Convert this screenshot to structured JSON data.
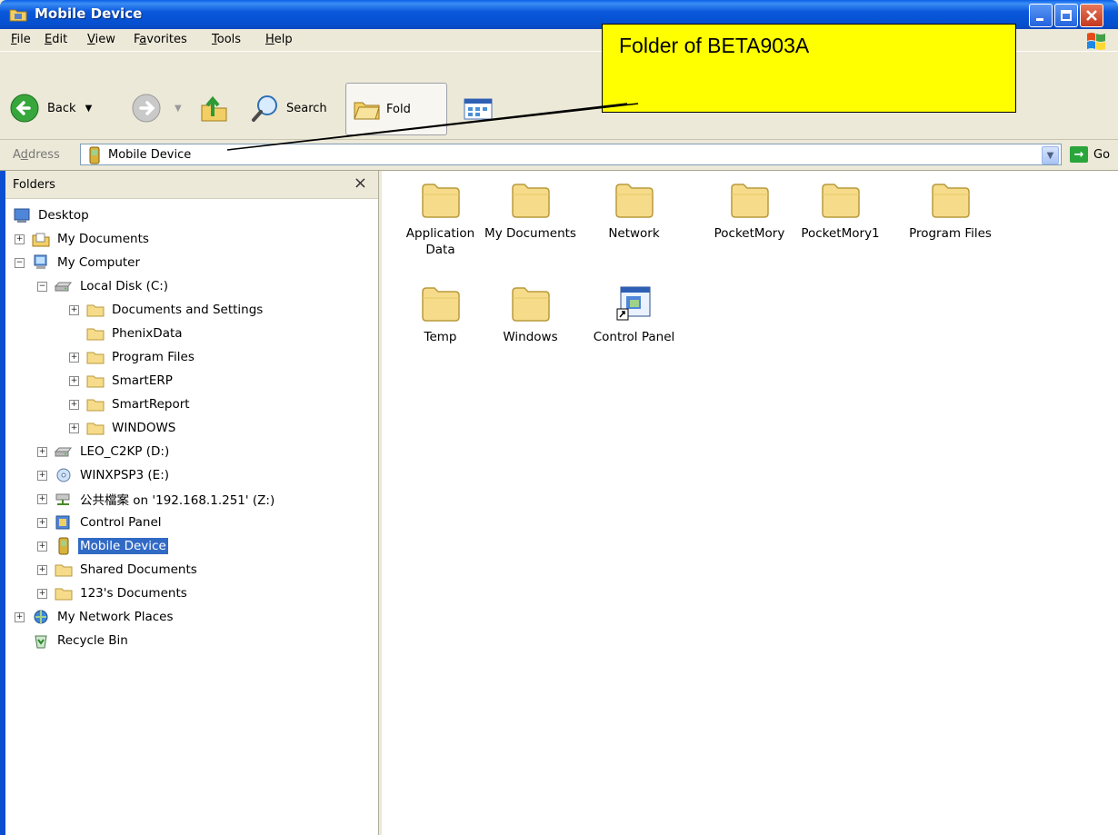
{
  "window": {
    "title": "Mobile Device"
  },
  "menu": [
    {
      "label": "File",
      "u": "F",
      "rest": "ile"
    },
    {
      "label": "Edit",
      "u": "E",
      "rest": "dit"
    },
    {
      "label": "View",
      "u": "V",
      "rest": "iew"
    },
    {
      "label": "Favorites",
      "pre": "F",
      "u": "a",
      "rest": "vorites"
    },
    {
      "label": "Tools",
      "u": "T",
      "rest": "ools"
    },
    {
      "label": "Help",
      "u": "H",
      "rest": "elp"
    }
  ],
  "toolbar": {
    "back_label": "Back",
    "search_label": "Search",
    "folders_label": "Fold"
  },
  "address": {
    "label_pre": "A",
    "label_u": "d",
    "label_rest": "dress",
    "value": "Mobile Device",
    "go_label": "Go"
  },
  "folders_pane": {
    "title": "Folders",
    "close": "×",
    "tree": [
      {
        "label": "Desktop",
        "icon": "desktop-icon",
        "level": 0,
        "expander": "none"
      },
      {
        "label": "My Documents",
        "icon": "my-documents-icon",
        "level": 1,
        "expander": "plus"
      },
      {
        "label": "My Computer",
        "icon": "my-computer-icon",
        "level": 1,
        "expander": "minus"
      },
      {
        "label": "Local Disk (C:)",
        "icon": "hard-drive-icon",
        "level": 2,
        "expander": "minus"
      },
      {
        "label": "Documents and Settings",
        "icon": "folder-icon",
        "level": 3,
        "expander": "plus"
      },
      {
        "label": "PhenixData",
        "icon": "folder-icon",
        "level": 3,
        "expander": "none"
      },
      {
        "label": "Program Files",
        "icon": "folder-icon",
        "level": 3,
        "expander": "plus"
      },
      {
        "label": "SmartERP",
        "icon": "folder-icon",
        "level": 3,
        "expander": "plus"
      },
      {
        "label": "SmartReport",
        "icon": "folder-icon",
        "level": 3,
        "expander": "plus"
      },
      {
        "label": "WINDOWS",
        "icon": "folder-icon",
        "level": 3,
        "expander": "plus"
      },
      {
        "label": "LEO_C2KP (D:)",
        "icon": "hard-drive-icon",
        "level": 2,
        "expander": "plus"
      },
      {
        "label": "WINXPSP3 (E:)",
        "icon": "cd-drive-icon",
        "level": 2,
        "expander": "plus"
      },
      {
        "label": "公共檔案 on '192.168.1.251' (Z:)",
        "icon": "network-drive-icon",
        "level": 2,
        "expander": "plus"
      },
      {
        "label": "Control Panel",
        "icon": "control-panel-icon",
        "level": 2,
        "expander": "plus"
      },
      {
        "label": "Mobile Device",
        "icon": "mobile-device-icon",
        "level": 2,
        "expander": "plus",
        "selected": true
      },
      {
        "label": "Shared Documents",
        "icon": "folder-icon",
        "level": 2,
        "expander": "plus"
      },
      {
        "label": "123's Documents",
        "icon": "folder-icon",
        "level": 2,
        "expander": "plus"
      },
      {
        "label": "My Network Places",
        "icon": "network-places-icon",
        "level": 1,
        "expander": "plus"
      },
      {
        "label": "Recycle Bin",
        "icon": "recycle-bin-icon",
        "level": 1,
        "expander": "none"
      }
    ]
  },
  "content": {
    "items": [
      {
        "label": "Application Data",
        "lines": [
          "Application",
          "Data"
        ],
        "icon": "folder-icon"
      },
      {
        "label": "My Documents",
        "lines": [
          "My Documents"
        ],
        "icon": "folder-icon"
      },
      {
        "label": "Network",
        "lines": [
          "Network"
        ],
        "icon": "folder-icon"
      },
      {
        "label": "PocketMory",
        "lines": [
          "PocketMory"
        ],
        "icon": "folder-icon"
      },
      {
        "label": "PocketMory1",
        "lines": [
          "PocketMory1"
        ],
        "icon": "folder-icon"
      },
      {
        "label": "Program Files",
        "lines": [
          "Program Files"
        ],
        "icon": "folder-icon"
      },
      {
        "label": "Temp",
        "lines": [
          "Temp"
        ],
        "icon": "folder-icon"
      },
      {
        "label": "Windows",
        "lines": [
          "Windows"
        ],
        "icon": "folder-icon"
      },
      {
        "label": "Control Panel",
        "lines": [
          "Control Panel"
        ],
        "icon": "control-panel-shortcut-icon"
      }
    ]
  },
  "callout": {
    "text": "Folder of BETA903A"
  },
  "colors": {
    "titlebar": "#0550d0",
    "selection": "#316ac5",
    "callout_fill": "#ffff00",
    "folder_fill": "#f6dc8a"
  }
}
